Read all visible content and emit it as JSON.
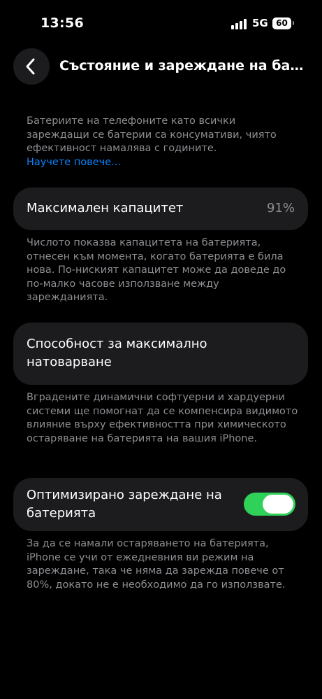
{
  "status_bar": {
    "time": "13:56",
    "network": "5G",
    "battery_level": "60",
    "signal_bars": 4
  },
  "nav": {
    "title": "Състояние и зареждане на батерията",
    "back_icon": "chevron-left-icon"
  },
  "intro": {
    "text": "Батериите на телефоните като всички зареждащи се батерии са консумативи, чиято ефективност намалява с годините.",
    "learn_more": "Научете повече..."
  },
  "max_capacity": {
    "label": "Максимален капацитет",
    "value": "91%",
    "description": "Числото показва капацитета на батерията, отнесен към момента, когато батерията е била нова. По-ниският капацитет може да доведе до по-малко часове използване между зарежданията."
  },
  "peak_performance": {
    "label": "Способност за максимално натоварване",
    "description": "Вградените динамични софтуерни и хардуерни системи ще помогнат да се компенсира видимото влияние върху ефективността при химическото остаряване на батерията на вашия iPhone."
  },
  "optimized_charging": {
    "label": "Оптимизирано зареждане на батерията",
    "enabled": true,
    "toggle_color": "#30d158",
    "description": "За да се намали остаряването на батерията, iPhone се учи от ежедневния ви режим на зареждане, така че няма да зарежда повече от 80%, докато не е необходимо да го използвате."
  },
  "colors": {
    "background": "#000000",
    "card": "#1c1c1e",
    "secondary_text": "#8e8e93",
    "link": "#0a84ff"
  }
}
